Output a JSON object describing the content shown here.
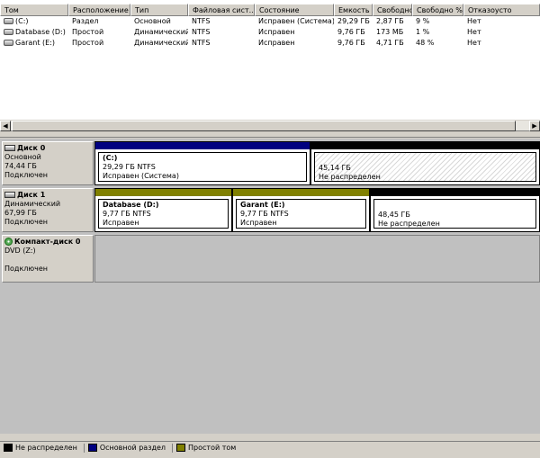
{
  "columns": [
    "Том",
    "Расположение",
    "Тип",
    "Файловая сист...",
    "Состояние",
    "Емкость",
    "Свободно",
    "Свободно %",
    "Отказоусто"
  ],
  "volumes": [
    [
      "(C:)",
      "Раздел",
      "Основной",
      "NTFS",
      "Исправен (Система)",
      "29,29 ГБ",
      "2,87 ГБ",
      "9 %",
      "Нет"
    ],
    [
      "Database (D:)",
      "Простой",
      "Динамический",
      "NTFS",
      "Исправен",
      "9,76 ГБ",
      "173 МБ",
      "1 %",
      "Нет"
    ],
    [
      "Garant (E:)",
      "Простой",
      "Динамический",
      "NTFS",
      "Исправен",
      "9,76 ГБ",
      "4,71 ГБ",
      "48 %",
      "Нет"
    ]
  ],
  "colors": {
    "unallocated": "#000000",
    "primary": "#000080",
    "simple": "#808000"
  },
  "disks": [
    {
      "name": "Диск 0",
      "type": "Основной",
      "size": "74,44 ГБ",
      "status": "Подключен",
      "partitions": [
        {
          "title": "(C:)",
          "line1": "29,29 ГБ NTFS",
          "line2": "Исправен (Система)",
          "kind": "primary"
        },
        {
          "title": "",
          "line1": "45,14 ГБ",
          "line2": "Не распределен",
          "kind": "unallocated"
        }
      ]
    },
    {
      "name": "Диск 1",
      "type": "Динамический",
      "size": "67,99 ГБ",
      "status": "Подключен",
      "partitions": [
        {
          "title": "Database  (D:)",
          "line1": "9,77 ГБ NTFS",
          "line2": "Исправен",
          "kind": "simple"
        },
        {
          "title": "Garant  (E:)",
          "line1": "9,77 ГБ NTFS",
          "line2": "Исправен",
          "kind": "simple"
        },
        {
          "title": "",
          "line1": "48,45 ГБ",
          "line2": "Не распределен",
          "kind": "unallocated"
        }
      ]
    },
    {
      "name": "Компакт-диск 0",
      "type": "DVD (Z:)",
      "size": "",
      "status": "Подключен",
      "partitions": []
    }
  ],
  "legend": [
    {
      "label": "Не распределен",
      "color": "#000000"
    },
    {
      "label": "Основной раздел",
      "color": "#000080"
    },
    {
      "label": "Простой том",
      "color": "#808000"
    }
  ]
}
